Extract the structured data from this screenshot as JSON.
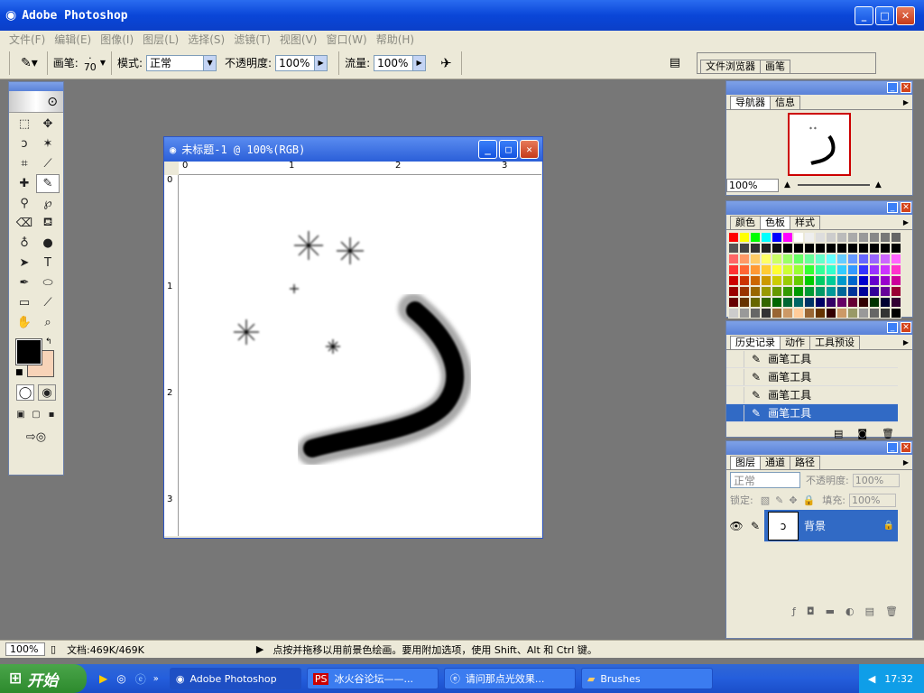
{
  "app": {
    "title": "Adobe Photoshop"
  },
  "menu": [
    "文件(F)",
    "编辑(E)",
    "图像(I)",
    "图层(L)",
    "选择(S)",
    "滤镜(T)",
    "视图(V)",
    "窗口(W)",
    "帮助(H)"
  ],
  "options": {
    "brush_label": "画笔:",
    "brush_size": "70",
    "mode_label": "模式:",
    "mode_value": "正常",
    "opacity_label": "不透明度:",
    "opacity_value": "100%",
    "flow_label": "流量:",
    "flow_value": "100%",
    "panel_tabs": [
      "文件浏览器",
      "画笔"
    ]
  },
  "document": {
    "title": "未标题-1 @ 100%(RGB)",
    "ruler_h": [
      "0",
      "1",
      "2",
      "3"
    ],
    "ruler_v": [
      "0",
      "1",
      "2",
      "3"
    ]
  },
  "navigator": {
    "tabs": [
      "导航器",
      "信息"
    ],
    "zoom": "100%"
  },
  "color": {
    "tabs": [
      "颜色",
      "色板",
      "样式"
    ]
  },
  "history": {
    "tabs": [
      "历史记录",
      "动作",
      "工具预设"
    ],
    "items": [
      "画笔工具",
      "画笔工具",
      "画笔工具",
      "画笔工具"
    ]
  },
  "layers": {
    "tabs": [
      "图层",
      "通道",
      "路径"
    ],
    "mode": "正常",
    "opacity_label": "不透明度:",
    "opacity": "100%",
    "lock_label": "锁定:",
    "fill_label": "填充:",
    "fill": "100%",
    "layer_name": "背景"
  },
  "status": {
    "zoom": "100%",
    "doc_info": "文档:469K/469K",
    "hint": "点按并拖移以用前景色绘画。要用附加选项，使用 Shift、Alt 和 Ctrl 键。"
  },
  "taskbar": {
    "start": "开始",
    "items": [
      "Adobe Photoshop",
      "冰火谷论坛——...",
      "请问那点光效果...",
      "Brushes"
    ],
    "clock": "17:32"
  },
  "colors": {
    "fg": "#000000",
    "bg": "#f7d3b8",
    "accent": "#316ac5"
  }
}
